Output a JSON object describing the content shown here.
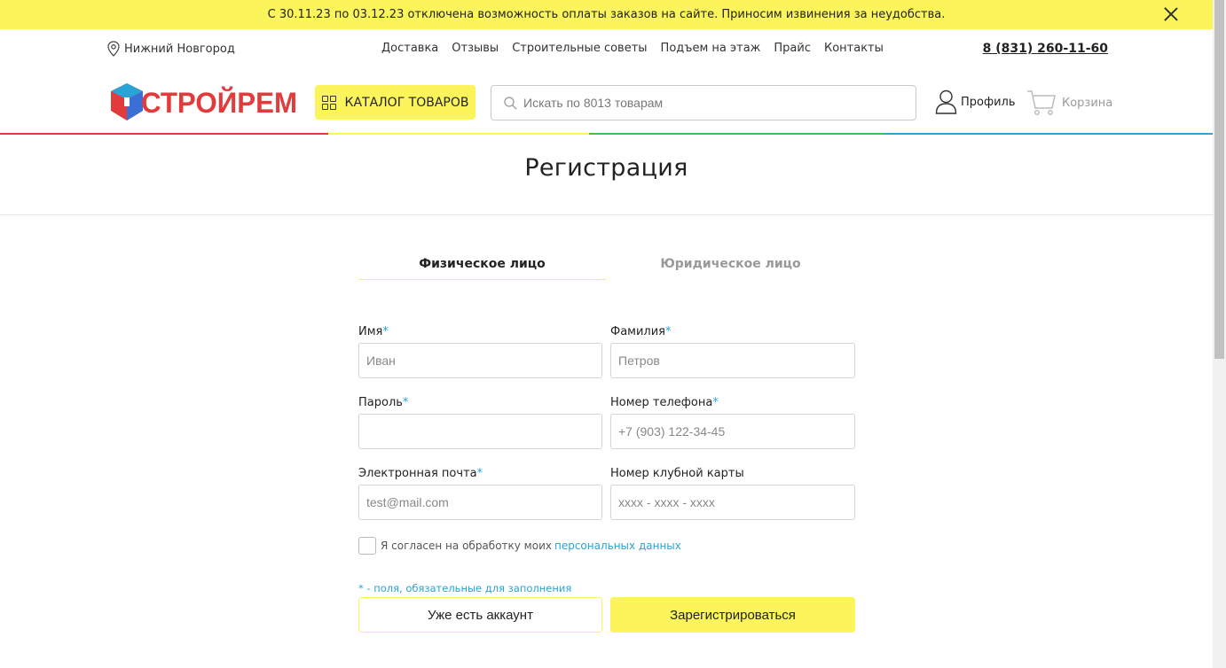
{
  "notice": {
    "text": "С 30.11.23 по 03.12.23 отключена возможность оплаты заказов на сайте. Приносим извинения за неудобства."
  },
  "header": {
    "city": "Нижний Новгород",
    "nav": [
      "Доставка",
      "Отзывы",
      "Строительные советы",
      "Подъем на этаж",
      "Прайс",
      "Контакты"
    ],
    "phone": "8 (831) 260-11-60",
    "logo_text": "СТРОЙРЕМ",
    "catalog_label": "КАТАЛОГ ТОВАРОВ",
    "search_placeholder": "Искать по 8013 товарам",
    "profile_label": "Профиль",
    "cart_label": "Корзина",
    "accent_colors": [
      "#e23b3b",
      "#fbf55b",
      "#3cc34a",
      "#2aa3d6"
    ]
  },
  "page": {
    "title": "Регистрация"
  },
  "tabs": {
    "individual": "Физическое лицо",
    "company": "Юридическое лицо"
  },
  "form": {
    "first_name": {
      "label": "Имя",
      "required": "*",
      "placeholder": "Иван"
    },
    "last_name": {
      "label": "Фамилия",
      "required": "*",
      "placeholder": "Петров"
    },
    "password": {
      "label": "Пароль",
      "required": "*",
      "placeholder": ""
    },
    "phone": {
      "label": "Номер телефона",
      "required": "*",
      "placeholder": "+7 (903) 122-34-45"
    },
    "email": {
      "label": "Электронная почта",
      "required": "*",
      "placeholder": "test@mail.com"
    },
    "club_card": {
      "label": "Номер клубной карты",
      "placeholder": "xxxx - xxxx - xxxx"
    },
    "consent_text": "Я согласен на обработку моих",
    "consent_link": "персональных данных",
    "required_note": "* - поля, обязательные для заполнения",
    "login_button": "Уже есть аккаунт",
    "register_button": "Зарегистрироваться"
  },
  "colors": {
    "accent_yellow": "#fbf55b",
    "link_blue": "#2aa3d6"
  }
}
